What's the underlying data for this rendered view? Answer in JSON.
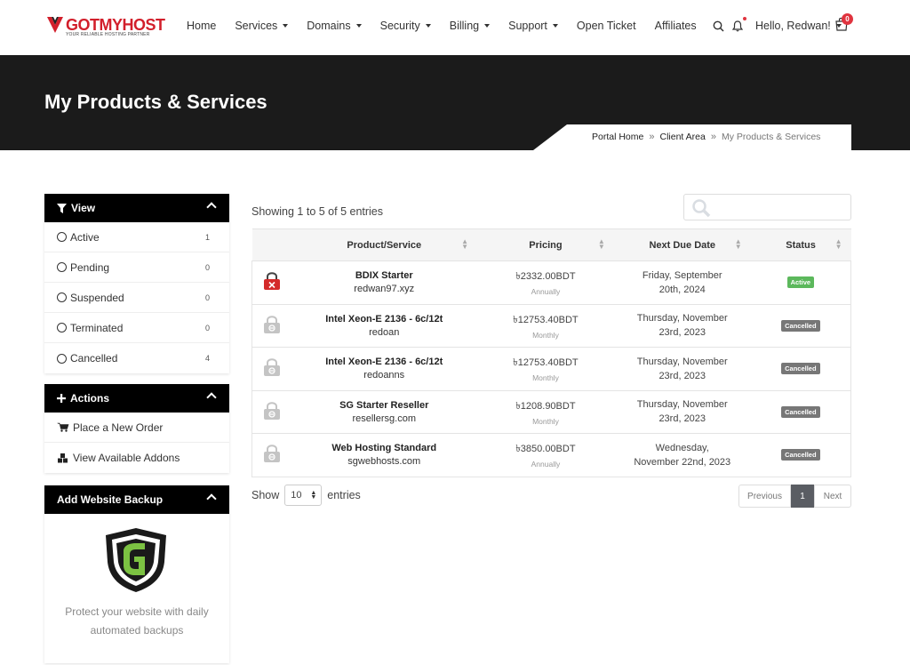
{
  "header": {
    "logo_text": "GOTMYHOST",
    "logo_tagline": "YOUR RELIABLE HOSTING PARTNER",
    "nav": [
      {
        "label": "Home",
        "dropdown": false
      },
      {
        "label": "Services",
        "dropdown": true
      },
      {
        "label": "Domains",
        "dropdown": true
      },
      {
        "label": "Security",
        "dropdown": true
      },
      {
        "label": "Billing",
        "dropdown": true
      },
      {
        "label": "Support",
        "dropdown": true
      },
      {
        "label": "Open Ticket",
        "dropdown": false
      },
      {
        "label": "Affiliates",
        "dropdown": false
      }
    ],
    "user_greeting": "Hello, Redwan!",
    "cart_count": "0"
  },
  "banner": {
    "title": "My Products & Services",
    "breadcrumbs": [
      "Portal Home",
      "Client Area",
      "My Products & Services"
    ]
  },
  "sidebar": {
    "view": {
      "title": "View",
      "items": [
        {
          "label": "Active",
          "count": "1"
        },
        {
          "label": "Pending",
          "count": "0"
        },
        {
          "label": "Suspended",
          "count": "0"
        },
        {
          "label": "Terminated",
          "count": "0"
        },
        {
          "label": "Cancelled",
          "count": "4"
        }
      ]
    },
    "actions": {
      "title": "Actions",
      "items": [
        {
          "label": "Place a New Order",
          "icon": "cart-icon"
        },
        {
          "label": "View Available Addons",
          "icon": "cubes-icon"
        }
      ]
    },
    "backup": {
      "title": "Add Website Backup",
      "text": "Protect your website with daily automated backups"
    }
  },
  "table": {
    "info": "Showing 1 to 5 of 5 entries",
    "columns": [
      "Product/Service",
      "Pricing",
      "Next Due Date",
      "Status"
    ],
    "rows": [
      {
        "name": "BDIX Starter",
        "domain": "redwan97.xyz",
        "price": "৳2332.00BDT",
        "cycle": "Annually",
        "due": "Friday, September 20th, 2024",
        "status": "Active",
        "icon": "lock-red-icon"
      },
      {
        "name": "Intel Xeon-E 2136 - 6c/12t",
        "domain": "redoan",
        "price": "৳12753.40BDT",
        "cycle": "Monthly",
        "due": "Thursday, November 23rd, 2023",
        "status": "Cancelled",
        "icon": "lock-gray-icon"
      },
      {
        "name": "Intel Xeon-E 2136 - 6c/12t",
        "domain": "redoanns",
        "price": "৳12753.40BDT",
        "cycle": "Monthly",
        "due": "Thursday, November 23rd, 2023",
        "status": "Cancelled",
        "icon": "lock-gray-icon"
      },
      {
        "name": "SG Starter Reseller",
        "domain": "resellersg.com",
        "price": "৳1208.90BDT",
        "cycle": "Monthly",
        "due": "Thursday, November 23rd, 2023",
        "status": "Cancelled",
        "icon": "lock-gray-icon"
      },
      {
        "name": "Web Hosting Standard",
        "domain": "sgwebhosts.com",
        "price": "৳3850.00BDT",
        "cycle": "Annually",
        "due": "Wednesday, November 22nd, 2023",
        "status": "Cancelled",
        "icon": "lock-gray-icon"
      }
    ],
    "show_label": "Show",
    "entries_label": "entries",
    "page_size": "10",
    "pagination": {
      "prev": "Previous",
      "current": "1",
      "next": "Next"
    }
  },
  "colors": {
    "brand_red": "#d21f2b",
    "active_green": "#5cb85c",
    "cancelled_gray": "#777777"
  }
}
